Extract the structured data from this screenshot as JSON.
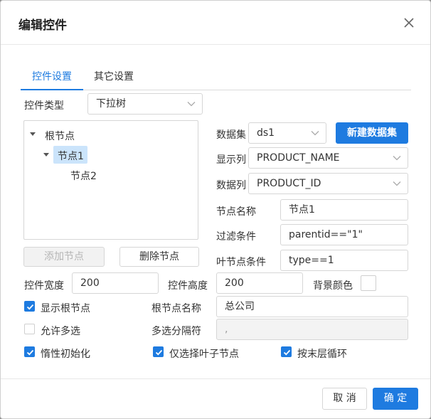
{
  "dialog": {
    "title": "编辑控件"
  },
  "tabs": [
    {
      "label": "控件设置",
      "active": true
    },
    {
      "label": "其它设置",
      "active": false
    }
  ],
  "control_type": {
    "label": "控件类型",
    "value": "下拉树"
  },
  "tree": {
    "nodes": [
      {
        "label": "根节点",
        "expanded": true
      },
      {
        "label": "节点1",
        "expanded": true,
        "selected": true
      },
      {
        "label": "节点2"
      }
    ]
  },
  "tree_buttons": {
    "add": "添加节点",
    "delete": "删除节点"
  },
  "dataset": {
    "label": "数据集",
    "value": "ds1",
    "new_button": "新建数据集"
  },
  "display_column": {
    "label": "显示列",
    "value": "PRODUCT_NAME"
  },
  "data_column": {
    "label": "数据列",
    "value": "PRODUCT_ID"
  },
  "node_name": {
    "label": "节点名称",
    "value": "节点1"
  },
  "filter": {
    "label": "过滤条件",
    "value": "parentid==\"1\""
  },
  "leaf_condition": {
    "label": "叶节点条件",
    "value": "type==1"
  },
  "width": {
    "label": "控件宽度",
    "value": "200"
  },
  "height": {
    "label": "控件高度",
    "value": "200"
  },
  "background": {
    "label": "背景颜色",
    "color": "#ffffff"
  },
  "show_root": {
    "label": "显示根节点",
    "checked": true
  },
  "root_name": {
    "label": "根节点名称",
    "value": "总公司"
  },
  "multi_select": {
    "label": "允许多选",
    "checked": false
  },
  "separator": {
    "label": "多选分隔符",
    "value": ","
  },
  "lazy_init": {
    "label": "惰性初始化",
    "checked": true
  },
  "leaf_only": {
    "label": "仅选择叶子节点",
    "checked": true
  },
  "last_level_loop": {
    "label": "按末层循环",
    "checked": true
  },
  "footer": {
    "cancel": "取 消",
    "ok": "确 定"
  },
  "colors": {
    "accent": "#1e7be0",
    "selection": "#cbe4fb"
  }
}
